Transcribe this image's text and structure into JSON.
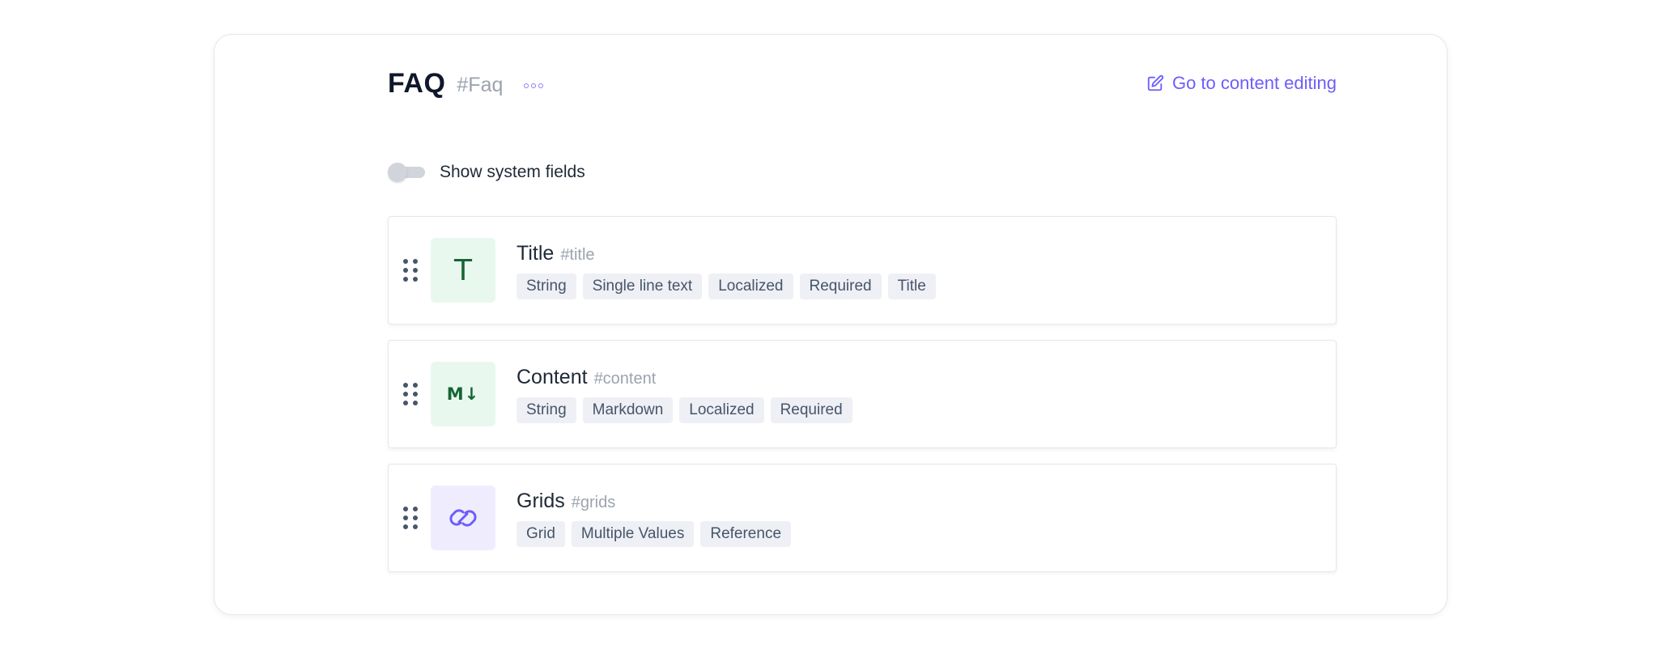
{
  "header": {
    "title": "FAQ",
    "id": "#Faq",
    "goto_label": "Go to content editing"
  },
  "system_fields": {
    "label": "Show system fields",
    "enabled": false
  },
  "fields": [
    {
      "name": "Title",
      "id": "#title",
      "icon": "text-icon",
      "icon_glyph": "T",
      "tags": [
        "String",
        "Single line text",
        "Localized",
        "Required",
        "Title"
      ]
    },
    {
      "name": "Content",
      "id": "#content",
      "icon": "markdown-icon",
      "icon_glyph": "M↓",
      "tags": [
        "String",
        "Markdown",
        "Localized",
        "Required"
      ]
    },
    {
      "name": "Grids",
      "id": "#grids",
      "icon": "link-icon",
      "tags": [
        "Grid",
        "Multiple Values",
        "Reference"
      ]
    }
  ],
  "colors": {
    "accent": "#6d5dfc",
    "tag_bg": "#eef0f5",
    "icon_green_bg": "#e9f8ee",
    "icon_purple_bg": "#efedfd"
  }
}
